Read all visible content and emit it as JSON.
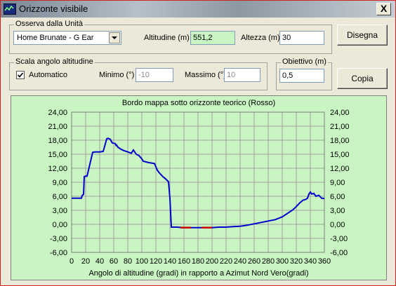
{
  "window": {
    "title": "Orizzonte visibile",
    "close_label": "X",
    "app_icon": "window-graph-icon"
  },
  "unit_group": {
    "label": "Osserva dalla Unità",
    "selected_unit": "Home Brunate - G Ear",
    "altitude_label": "Altitudine (m)",
    "altitude_value": "551,2",
    "height_label": "Altezza (m)",
    "height_value": "30"
  },
  "scale_group": {
    "label": "Scala angolo altitudine",
    "automatic_label": "Automatico",
    "automatic_checked": true,
    "min_label": "Minimo (°)",
    "min_value": "-10",
    "max_label": "Massimo (°)",
    "max_value": "10"
  },
  "objective_group": {
    "label": "Obiettivo (m)",
    "value": "0,5"
  },
  "buttons": {
    "draw": "Disegna",
    "copy": "Copia"
  },
  "colors": {
    "panel_bg": "#c8f5c2",
    "line": "#0000cc",
    "highlight": "#cc0000"
  },
  "chart_data": {
    "type": "line",
    "title": "Bordo mappa sotto orizzonte teorico (Rosso)",
    "xlabel": "Angolo di altitudine (gradi) in rapporto a Azimut Nord Vero(gradi)",
    "ylabel": "",
    "xlim": [
      0,
      360
    ],
    "ylim": [
      -6,
      24
    ],
    "x_ticks": [
      "0",
      "20",
      "40",
      "60",
      "80",
      "100",
      "120",
      "140",
      "160",
      "180",
      "200",
      "220",
      "240",
      "260",
      "280",
      "300",
      "320",
      "340",
      "360"
    ],
    "y_ticks": [
      "24,00",
      "21,00",
      "18,00",
      "15,00",
      "12,00",
      "9,00",
      "6,00",
      "3,00",
      "0,00",
      "-3,00",
      "-6,00"
    ],
    "grid": true,
    "series": [
      {
        "x": [
          0,
          14,
          15,
          17,
          18,
          20,
          22,
          30,
          34,
          40,
          45,
          50,
          52,
          55,
          58,
          62,
          63,
          64,
          66,
          70,
          74,
          80,
          85,
          88,
          92,
          96,
          100,
          102,
          110,
          118,
          120,
          122,
          125,
          130,
          134,
          138,
          140,
          142,
          150,
          160,
          170,
          180,
          190,
          200,
          210,
          220,
          230,
          240,
          250,
          260,
          270,
          280,
          290,
          300,
          305,
          310,
          315,
          320,
          325,
          330,
          333,
          336,
          338,
          340,
          342,
          345,
          348,
          352,
          356,
          360
        ],
        "y": [
          5.6,
          5.6,
          6.2,
          6.4,
          10.2,
          10.3,
          10.3,
          15.4,
          15.5,
          15.5,
          15.6,
          18.3,
          18.4,
          18.2,
          17.4,
          17.3,
          16.9,
          17.0,
          16.5,
          16.1,
          15.8,
          15.5,
          15.2,
          15.9,
          15.0,
          14.7,
          14.0,
          13.5,
          13.2,
          13.0,
          12.3,
          11.6,
          11.0,
          10.2,
          9.7,
          9.1,
          5.6,
          -0.6,
          -0.6,
          -0.7,
          -0.7,
          -0.7,
          -0.7,
          -0.7,
          -0.6,
          -0.6,
          -0.5,
          -0.4,
          -0.2,
          0.1,
          0.4,
          0.7,
          1.0,
          1.6,
          2.1,
          2.6,
          3.1,
          3.8,
          4.6,
          5.2,
          5.3,
          5.6,
          6.5,
          6.9,
          6.5,
          6.6,
          6.0,
          6.2,
          5.6,
          5.5
        ]
      },
      {
        "x": [
          155,
          165,
          170
        ],
        "y": [
          -0.7,
          -0.7,
          -0.7
        ]
      },
      {
        "x": [
          185,
          200
        ],
        "y": [
          -0.7,
          -0.7
        ]
      }
    ]
  }
}
